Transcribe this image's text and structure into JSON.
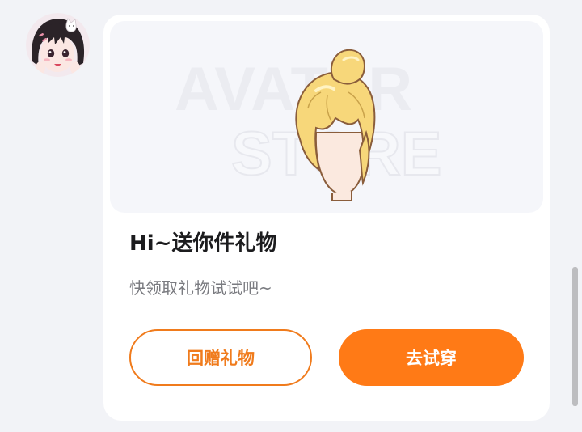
{
  "avatar": {
    "icon": "anime-girl-avatar-icon"
  },
  "card": {
    "banner": {
      "watermark_line1": "AVATAR",
      "watermark_line2": "STORE",
      "product_icon": "blonde-bun-hairstyle-icon"
    },
    "title": "Hi~送你件礼物",
    "subtitle": "快领取礼物试试吧~",
    "buttons": {
      "gift_back_label": "回赠礼物",
      "try_on_label": "去试穿"
    }
  },
  "colors": {
    "accent": "#ff7a16",
    "accent_outline": "#f07b1c",
    "background": "#f2f3f7",
    "card": "#ffffff"
  }
}
